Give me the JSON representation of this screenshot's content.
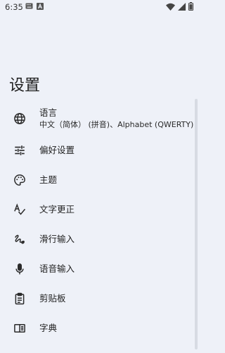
{
  "status_bar": {
    "time": "6:35",
    "left_icons": [
      "keyboard-icon",
      "text-a-icon"
    ],
    "right_icons": [
      "wifi-icon",
      "signal-icon",
      "battery-icon"
    ]
  },
  "page": {
    "title": "设置"
  },
  "settings": [
    {
      "id": "language",
      "icon": "globe-icon",
      "title": "语言",
      "subtitle": "中文（简体） (拼音)、Alphabet (QWERTY)"
    },
    {
      "id": "preferences",
      "icon": "tune-icon",
      "title": "偏好设置"
    },
    {
      "id": "theme",
      "icon": "palette-icon",
      "title": "主题"
    },
    {
      "id": "text-correction",
      "icon": "spellcheck-icon",
      "title": "文字更正"
    },
    {
      "id": "glide-typing",
      "icon": "gesture-icon",
      "title": "滑行输入"
    },
    {
      "id": "voice-input",
      "icon": "microphone-icon",
      "title": "语音输入"
    },
    {
      "id": "clipboard",
      "icon": "clipboard-icon",
      "title": "剪贴板"
    },
    {
      "id": "dictionary",
      "icon": "dictionary-icon",
      "title": "字典"
    }
  ],
  "colors": {
    "background": "#eef1f8",
    "text": "#1f1f1f",
    "icon": "#2b2b2b",
    "scrollbar": "#d7dbe3"
  }
}
